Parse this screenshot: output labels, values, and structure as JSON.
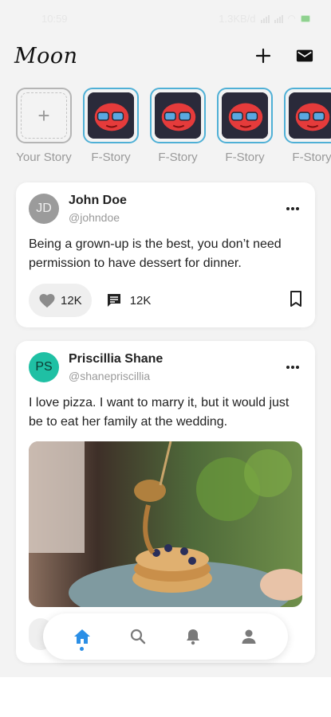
{
  "status": {
    "time": "10:59",
    "speed": "1.3KB/d",
    "battery": "4"
  },
  "header": {
    "logo": "Moon",
    "add_icon": "plus-icon",
    "messages_icon": "mail-icon"
  },
  "stories": [
    {
      "label": "Your Story",
      "type": "add"
    },
    {
      "label": "F-Story",
      "type": "image"
    },
    {
      "label": "F-Story",
      "type": "image"
    },
    {
      "label": "F-Story",
      "type": "image"
    },
    {
      "label": "F-Story",
      "type": "image"
    }
  ],
  "posts": [
    {
      "initials": "JD",
      "name": "John Doe",
      "handle": "@johndoe",
      "text": "Being a grown-up is the best, you don’t need permission to have dessert for dinner.",
      "likes": "12K",
      "comments": "12K"
    },
    {
      "initials": "PS",
      "name": "Priscillia Shane",
      "handle": "@shanepriscillia",
      "text": "I love pizza. I want to marry it, but it would just be to eat her family at the wedding."
    }
  ],
  "nav": {
    "items": [
      "home-icon",
      "search-icon",
      "bell-icon",
      "person-icon"
    ],
    "active": "home-icon"
  },
  "colors": {
    "accent": "#2b8fe6",
    "story_ring": "#4fb0d6",
    "avatar_teal": "#1fc0a4"
  }
}
